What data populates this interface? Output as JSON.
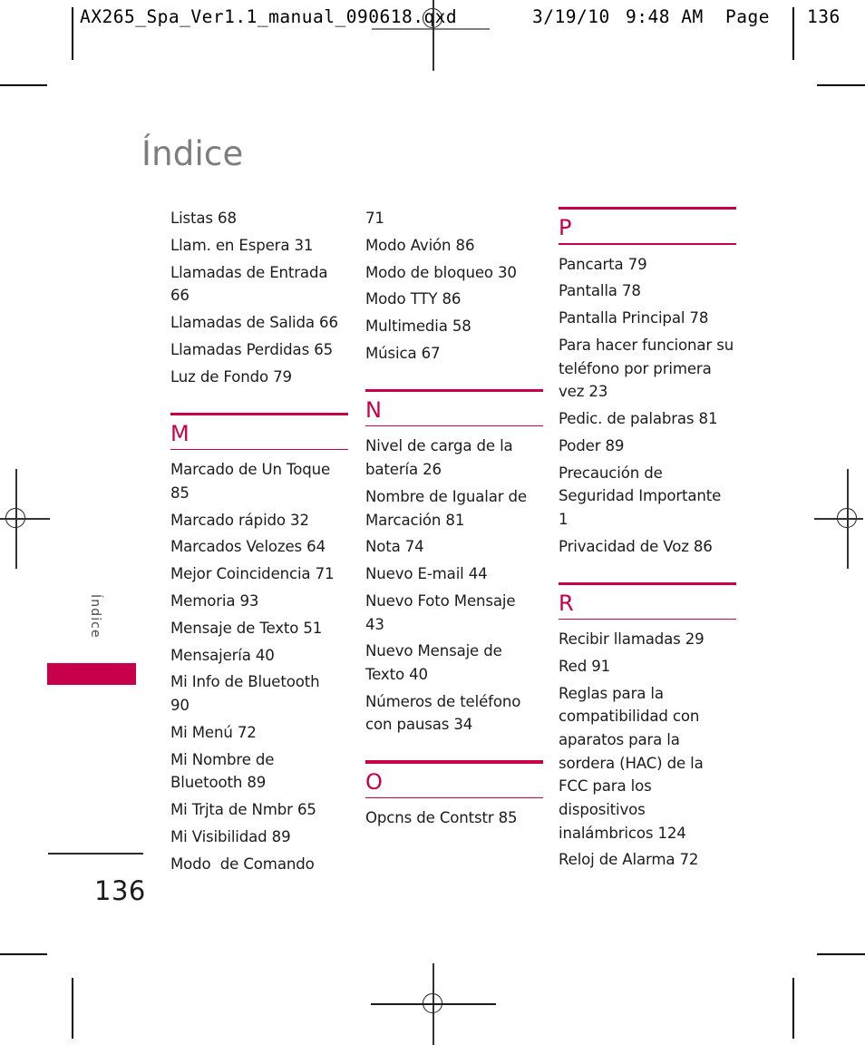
{
  "proof_header": {
    "filename": "AX265_Spa_Ver1.1_manual_090618.qxd",
    "date": "3/19/10",
    "time": "9:48 AM",
    "page_label": "Page",
    "page_value": "136"
  },
  "page": {
    "title": "Índice",
    "side_tab_label": "Índice",
    "page_number": "136",
    "accent_color": "#c8004b",
    "title_color": "#7d7d7d",
    "text_color": "#1c1c1c"
  },
  "columns": [
    {
      "id": "column-1",
      "blocks": [
        {
          "type": "entries",
          "items": [
            "Listas 68",
            "Llam. en Espera 31",
            "Llamadas de Entrada\n66",
            "Llamadas de Salida 66",
            "Llamadas Perdidas 65",
            "Luz de Fondo 79"
          ]
        },
        {
          "type": "section",
          "letter": "M",
          "items": [
            "Marcado de Un Toque\n85",
            "Marcado rápido 32",
            "Marcados Velozes 64",
            "Mejor Coincidencia 71",
            "Memoria 93",
            "Mensaje de Texto 51",
            "Mensajería 40",
            "Mi Info de Bluetooth\n90",
            "Mi Menú 72",
            "Mi Nombre de\nBluetooth 89",
            "Mi Trjta de Nmbr 65",
            "Mi Visibilidad 89",
            "Modo  de Comando"
          ]
        }
      ]
    },
    {
      "id": "column-2",
      "blocks": [
        {
          "type": "entries",
          "items": [
            "71",
            "Modo Avión 86",
            "Modo de bloqueo 30",
            "Modo TTY 86",
            "Multimedia 58",
            "Música 67"
          ]
        },
        {
          "type": "section",
          "letter": "N",
          "items": [
            "Nivel de carga de la\nbatería 26",
            "Nombre de Igualar de\nMarcación 81",
            "Nota 74",
            "Nuevo E-mail 44",
            "Nuevo Foto Mensaje\n43",
            "Nuevo Mensaje de\nTexto 40",
            "Números de teléfono\ncon pausas 34"
          ]
        },
        {
          "type": "section",
          "letter": "O",
          "items": [
            "Opcns de Contstr 85"
          ]
        }
      ]
    },
    {
      "id": "column-3",
      "blocks": [
        {
          "type": "section",
          "letter": "P",
          "first": true,
          "items": [
            "Pancarta 79",
            "Pantalla 78",
            "Pantalla Principal 78",
            "Para hacer funcionar su\nteléfono por primera\nvez 23",
            "Pedic. de palabras 81",
            "Poder 89",
            "Precaución de\nSeguridad Importante\n1",
            "Privacidad de Voz 86"
          ]
        },
        {
          "type": "section",
          "letter": "R",
          "items": [
            "Recibir llamadas 29",
            "Red 91",
            "Reglas para la\ncompatibilidad con\naparatos para la\nsordera (HAC) de la\nFCC para los\ndispositivos\ninalámbricos 124",
            "Reloj de Alarma 72"
          ]
        }
      ]
    }
  ]
}
